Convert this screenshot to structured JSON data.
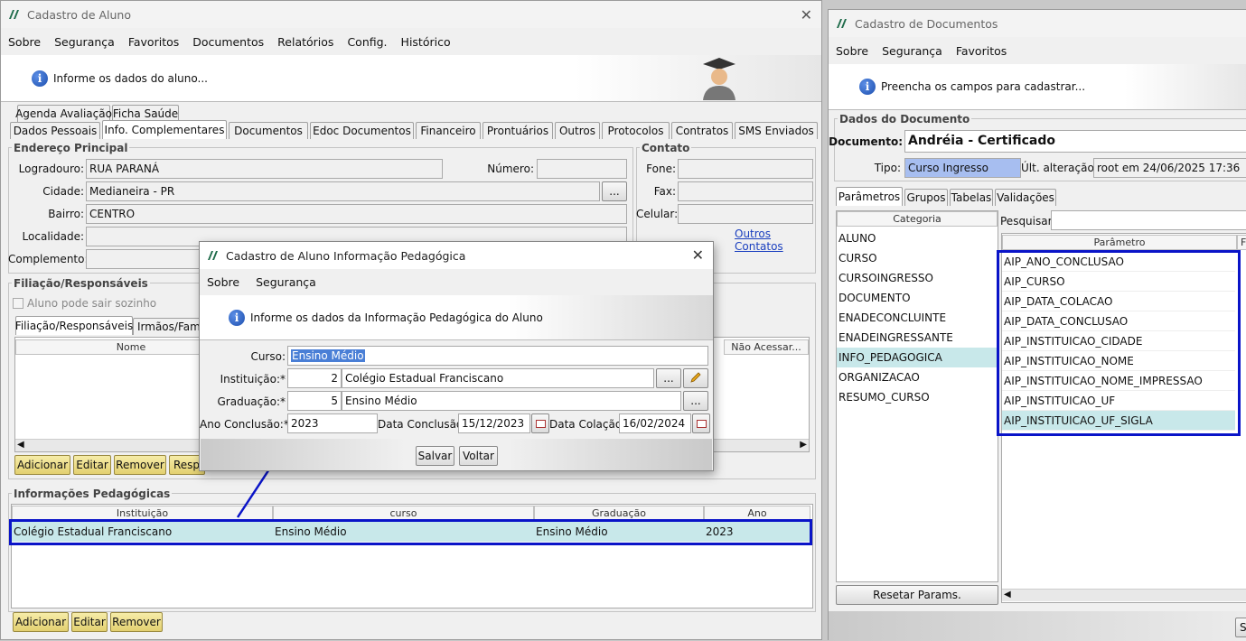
{
  "left_window": {
    "title": "Cadastro de Aluno",
    "menu": [
      "Sobre",
      "Segurança",
      "Favoritos",
      "Documentos",
      "Relatórios",
      "Config.",
      "Histórico"
    ],
    "banner": "Informe os dados do aluno...",
    "tabs_row1": [
      "Agenda Avaliação",
      "Ficha Saúde"
    ],
    "tabs_row2": [
      "Dados Pessoais",
      "Info. Complementares",
      "Documentos",
      "Edoc Documentos",
      "Financeiro",
      "Prontuários",
      "Outros",
      "Protocolos",
      "Contratos",
      "SMS Enviados"
    ],
    "endereco": {
      "title": "Endereço Principal",
      "logradouro_label": "Logradouro:",
      "logradouro": "RUA PARANÁ",
      "numero_label": "Número:",
      "numero": "",
      "cidade_label": "Cidade:",
      "cidade": "Medianeira - PR",
      "bairro_label": "Bairro:",
      "bairro": "CENTRO",
      "localidade_label": "Localidade:",
      "complemento_label": "Complemento:"
    },
    "contato": {
      "title": "Contato",
      "fone_label": "Fone:",
      "fax_label": "Fax:",
      "celular_label": "Celular:",
      "outros": "Outros Contatos"
    },
    "filiacao": {
      "title": "Filiação/Responsáveis",
      "checkbox": "Aluno pode sair sozinho",
      "subtabs": [
        "Filiação/Responsáveis",
        "Irmãos/Famil"
      ],
      "col_nome": "Nome",
      "col_nao": "Não Acessar...",
      "buttons": [
        "Adicionar",
        "Editar",
        "Remover",
        "Respo"
      ]
    },
    "info_ped": {
      "title": "Informações Pedagógicas",
      "columns": [
        "Instituição",
        "curso",
        "Graduação",
        "Ano"
      ],
      "row": [
        "Colégio Estadual Franciscano",
        "Ensino Médio",
        "Ensino Médio",
        "2023"
      ],
      "buttons": [
        "Adicionar",
        "Editar",
        "Remover"
      ]
    }
  },
  "dialog": {
    "title": "Cadastro de Aluno Informação Pedagógica",
    "menu": [
      "Sobre",
      "Segurança"
    ],
    "banner": "Informe os dados da Informação Pedagógica do Aluno",
    "curso_label": "Curso:",
    "curso": "Ensino Médio",
    "instituicao_label": "Instituição:*",
    "instituicao_code": "2",
    "instituicao": "Colégio Estadual Franciscano",
    "graduacao_label": "Graduação:*",
    "graduacao_code": "5",
    "graduacao": "Ensino Médio",
    "ano_label": "Ano Conclusão:*",
    "ano": "2023",
    "data_conclusao_label": "Data Conclusão:",
    "data_conclusao": "15/12/2023",
    "data_colacao_label": "Data Colação:",
    "data_colacao": "16/02/2024",
    "ellipsis": "...",
    "salvar": "Salvar",
    "voltar": "Voltar"
  },
  "right_window": {
    "title": "Cadastro de Documentos",
    "menu": [
      "Sobre",
      "Segurança",
      "Favoritos"
    ],
    "banner": "Preencha os campos para cadastrar...",
    "group_title": "Dados do Documento",
    "documento_label": "Documento:",
    "documento": "Andréia - Certificado",
    "tipo_label": "Tipo:",
    "tipo": "Curso Ingresso",
    "ult_label": "Últ. alteração:",
    "ult": "root em 24/06/2025 17:36",
    "tabs": [
      "Parâmetros",
      "Grupos",
      "Tabelas",
      "Validações"
    ],
    "categoria_header": "Categoria",
    "categorias": [
      "ALUNO",
      "CURSO",
      "CURSOINGRESSO",
      "DOCUMENTO",
      "ENADECONCLUINTE",
      "ENADEINGRESSANTE",
      "INFO_PEDAGOGICA",
      "ORGANIZACAO",
      "RESUMO_CURSO"
    ],
    "pesquisar_label": "Pesquisar:",
    "parametro_header": "Parâmetro",
    "parametro_header2": "F",
    "parametros": [
      "AIP_ANO_CONCLUSAO",
      "AIP_CURSO",
      "AIP_DATA_COLACAO",
      "AIP_DATA_CONCLUSAO",
      "AIP_INSTITUICAO_CIDADE",
      "AIP_INSTITUICAO_NOME",
      "AIP_INSTITUICAO_NOME_IMPRESSAO",
      "AIP_INSTITUICAO_UF",
      "AIP_INSTITUICAO_UF_SIGLA"
    ],
    "resetar": "Resetar Params.",
    "corner_btn": "S"
  },
  "colors": {
    "highlight": "#c8e8ea",
    "annotation": "#0a14c8",
    "tipo_bg": "#a7bef0"
  }
}
